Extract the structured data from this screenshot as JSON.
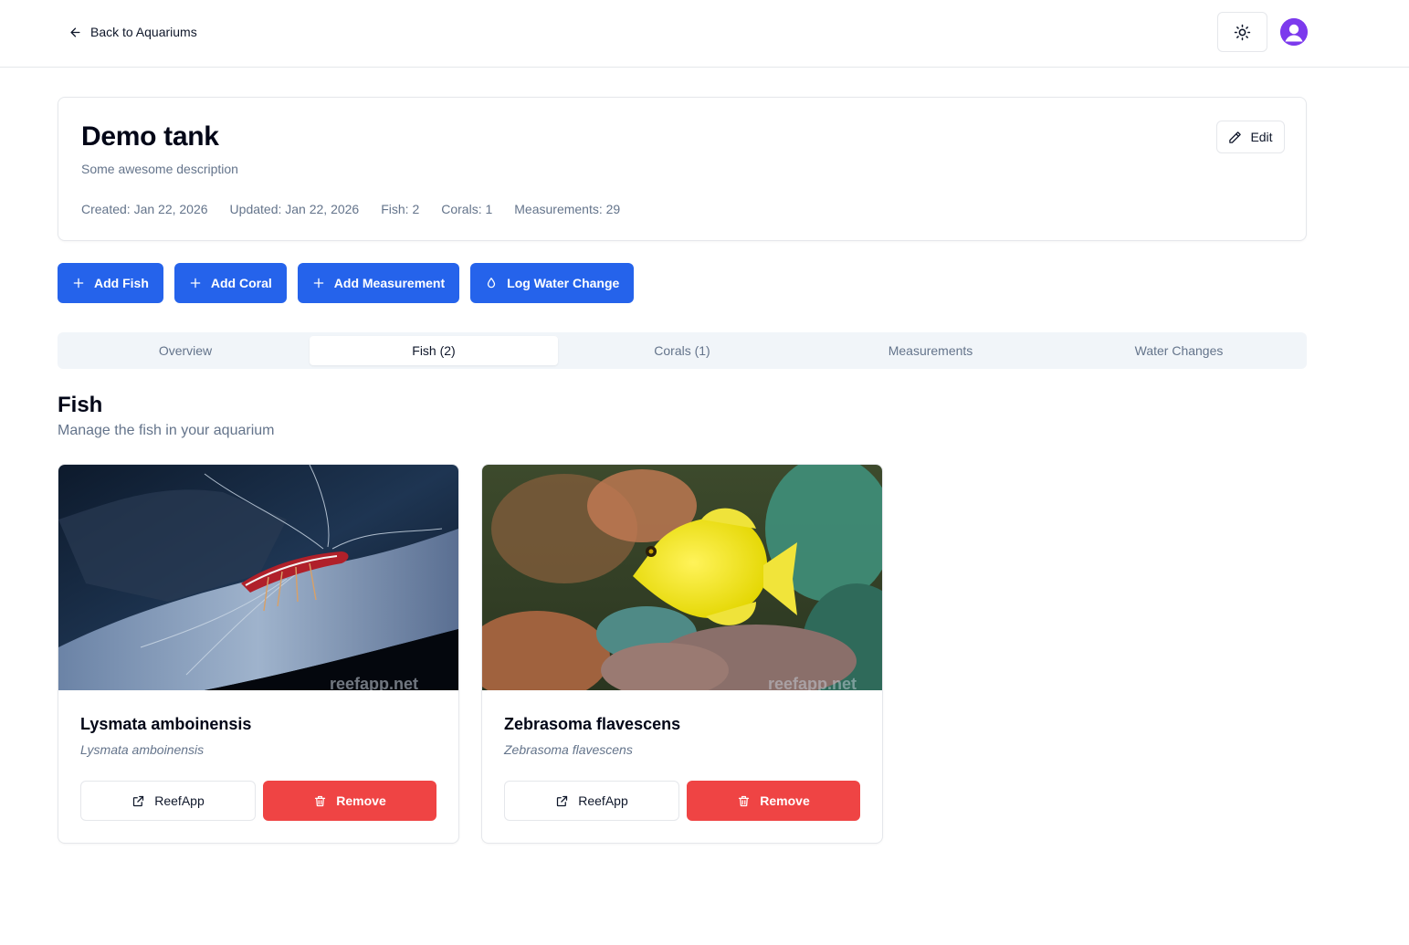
{
  "header": {
    "back_label": "Back to Aquariums",
    "back_icon": "arrow-left-icon",
    "theme_icon": "sun-icon",
    "avatar_icon": "user-icon"
  },
  "tank": {
    "title": "Demo tank",
    "description": "Some awesome description",
    "stats": {
      "created": "Created: Jan 22, 2026",
      "updated": "Updated: Jan 22, 2026",
      "fish": "Fish: 2",
      "corals": "Corals: 1",
      "measurements": "Measurements: 29"
    },
    "edit_label": "Edit",
    "edit_icon": "pencil-icon"
  },
  "actions": [
    {
      "label": "Add Fish",
      "icon": "plus-icon"
    },
    {
      "label": "Add Coral",
      "icon": "plus-icon"
    },
    {
      "label": "Add Measurement",
      "icon": "plus-icon"
    },
    {
      "label": "Log Water Change",
      "icon": "droplet-icon"
    }
  ],
  "tabs": [
    {
      "label": "Overview",
      "active": false
    },
    {
      "label": "Fish (2)",
      "active": true
    },
    {
      "label": "Corals (1)",
      "active": false
    },
    {
      "label": "Measurements",
      "active": false
    },
    {
      "label": "Water Changes",
      "active": false
    }
  ],
  "section": {
    "title": "Fish",
    "subtitle": "Manage the fish in your aquarium"
  },
  "fish": [
    {
      "name": "Lysmata amboinensis",
      "scientific": "Lysmata amboinensis",
      "link_label": "ReefApp",
      "remove_label": "Remove",
      "watermark": "reefapp.net"
    },
    {
      "name": "Zebrasoma flavescens",
      "scientific": "Zebrasoma flavescens",
      "link_label": "ReefApp",
      "remove_label": "Remove",
      "watermark": "reefapp.net"
    }
  ],
  "colors": {
    "primary": "#2563eb",
    "danger": "#ef4444",
    "avatar": "#7c3aed",
    "muted_text": "#64748b",
    "tab_bg": "#f1f5f9"
  }
}
